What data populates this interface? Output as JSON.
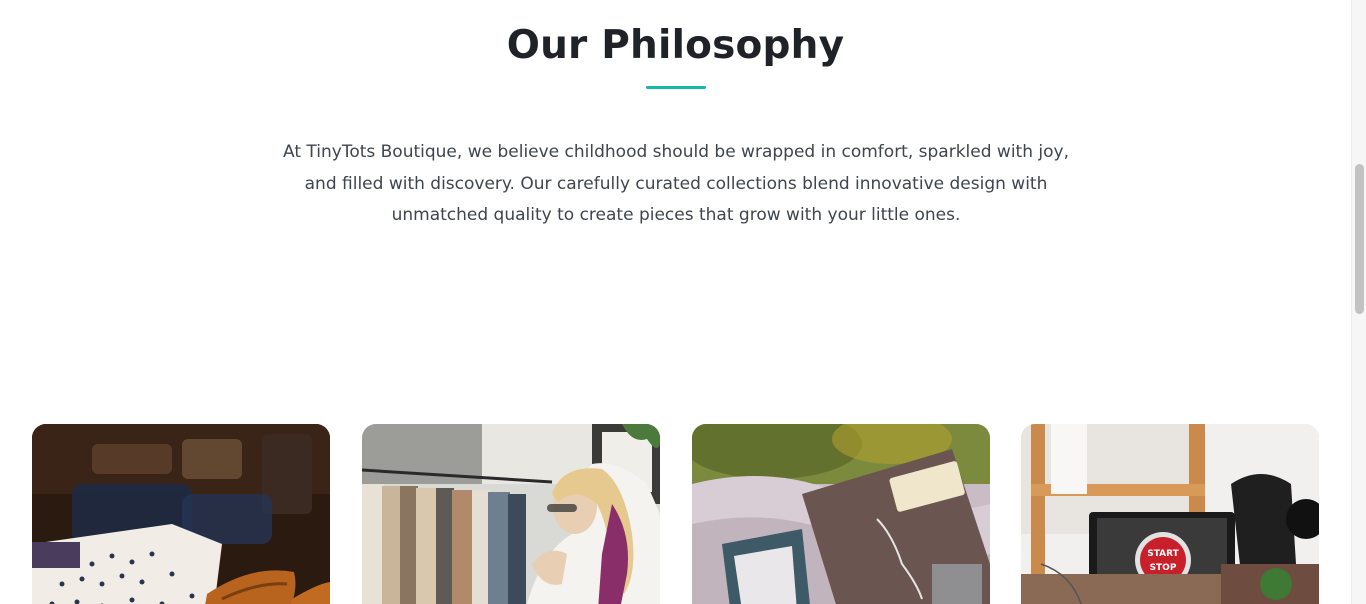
{
  "philosophy": {
    "title": "Our Philosophy",
    "lead": "At TinyTots Boutique, we believe childhood should be wrapped in comfort, sparkled with joy, and filled with discovery. Our carefully curated collections blend innovative design with unmatched quality to create pieces that grow with your little ones.",
    "accent_color": "#14b8a6"
  },
  "gallery": {
    "cards": [
      {
        "image": "folded-shirts-and-leather-shoes"
      },
      {
        "image": "woman-browsing-clothing-rack"
      },
      {
        "image": "jewelry-box-and-gift-tag"
      },
      {
        "image": "laptop-on-desk"
      }
    ],
    "laptop_screen_text": [
      "START",
      "STOP"
    ]
  }
}
